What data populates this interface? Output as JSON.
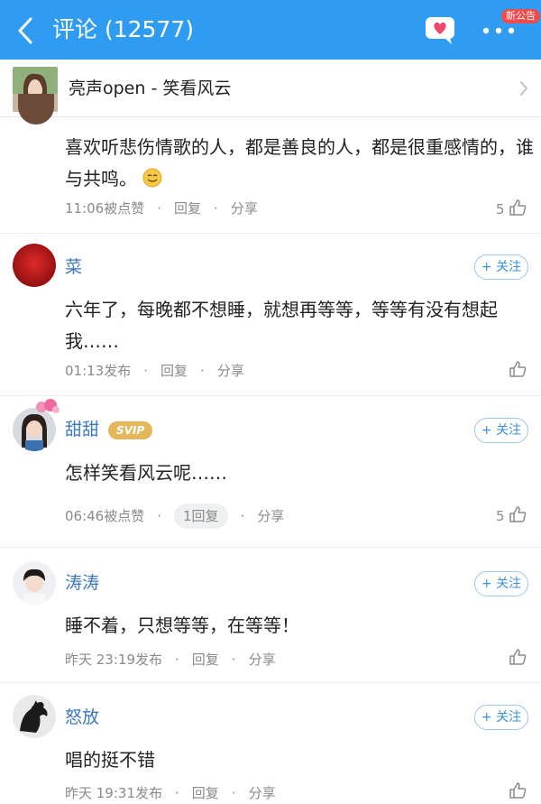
{
  "header": {
    "title": "评论 (12577)",
    "badge": "新公告",
    "bg_color": "#2f9cf2"
  },
  "song": {
    "title": "亮声open - 笑看风云"
  },
  "comments": [
    {
      "username": "",
      "text": "喜欢听悲伤情歌的人，都是善良的人，都是很重感情的，谁与共鸣。",
      "emoji": "smile-emoji",
      "time": "11:06被点赞",
      "reply": "回复",
      "share": "分享",
      "likes": "5"
    },
    {
      "username": "菜",
      "follow": "+ 关注",
      "text": "六年了，每晚都不想睡，就想再等等，等等有没有想起我……",
      "time": "01:13发布",
      "reply": "回复",
      "share": "分享",
      "likes": ""
    },
    {
      "username": "甜甜",
      "vip": "SVIP",
      "follow": "+ 关注",
      "text": "怎样笑看风云呢……",
      "time": "06:46被点赞",
      "reply": "1回复",
      "share": "分享",
      "likes": "5"
    },
    {
      "username": "涛涛",
      "follow": "+ 关注",
      "text": "睡不着，只想等等，在等等！",
      "time": "昨天 23:19发布",
      "reply": "回复",
      "share": "分享",
      "likes": ""
    },
    {
      "username": "怒放",
      "follow": "+ 关注",
      "text": "唱的挺不错",
      "time": "昨天 19:31发布",
      "reply": "回复",
      "share": "分享",
      "likes": ""
    }
  ]
}
